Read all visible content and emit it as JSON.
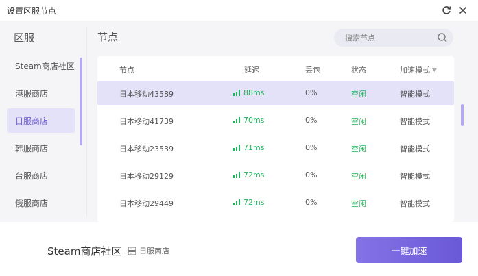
{
  "window": {
    "title": "设置区服节点"
  },
  "sidebar": {
    "title": "区服",
    "items": [
      {
        "label": "Steam商店社区",
        "active": false
      },
      {
        "label": "港服商店",
        "active": false
      },
      {
        "label": "日服商店",
        "active": true
      },
      {
        "label": "韩服商店",
        "active": false
      },
      {
        "label": "台服商店",
        "active": false
      },
      {
        "label": "俄服商店",
        "active": false
      }
    ]
  },
  "nodes": {
    "title": "节点",
    "search": {
      "placeholder": "搜索节点",
      "value": ""
    },
    "columns": {
      "name": "节点",
      "latency": "延迟",
      "loss": "丢包",
      "status": "状态",
      "mode": "加速模式"
    },
    "rows": [
      {
        "name": "日本移动43589",
        "latency": "88ms",
        "loss": "0%",
        "status": "空闲",
        "mode": "智能模式",
        "selected": true
      },
      {
        "name": "日本移动41739",
        "latency": "70ms",
        "loss": "0%",
        "status": "空闲",
        "mode": "智能模式",
        "selected": false
      },
      {
        "name": "日本移动23539",
        "latency": "71ms",
        "loss": "0%",
        "status": "空闲",
        "mode": "智能模式",
        "selected": false
      },
      {
        "name": "日本移动29129",
        "latency": "72ms",
        "loss": "0%",
        "status": "空闲",
        "mode": "智能模式",
        "selected": false
      },
      {
        "name": "日本移动29449",
        "latency": "72ms",
        "loss": "0%",
        "status": "空闲",
        "mode": "智能模式",
        "selected": false
      }
    ]
  },
  "footer": {
    "game": "Steam商店社区",
    "region": "日服商店",
    "accelerate_label": "一键加速"
  },
  "colors": {
    "accent": "#6f5fd8",
    "selected_bg": "#e4e2f9",
    "good_green": "#21b35b"
  },
  "icons": {
    "refresh": "refresh-icon",
    "close": "close-icon",
    "search": "search-icon",
    "signal": "signal-bars-icon",
    "sort": "caret-down-icon",
    "region": "server-icon"
  }
}
